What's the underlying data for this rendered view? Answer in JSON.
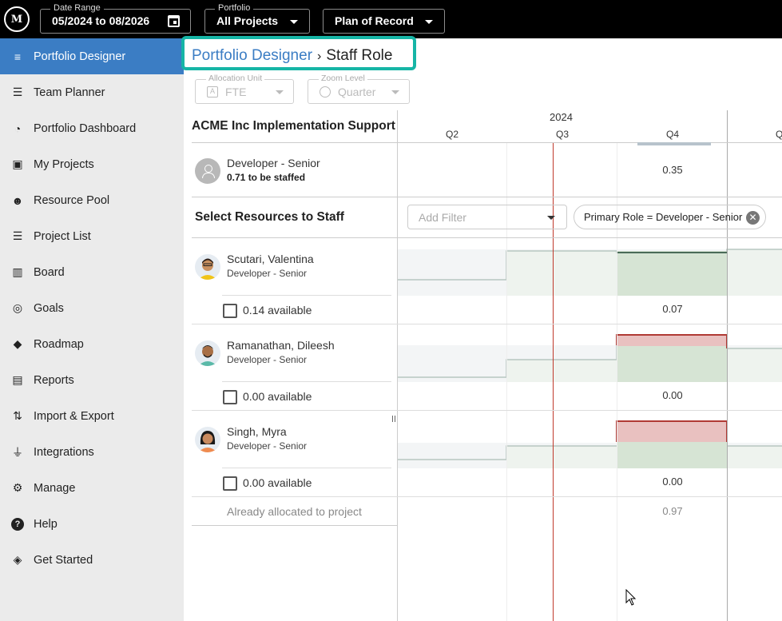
{
  "topbar": {
    "logo_text": "M",
    "date_range": {
      "label": "Date Range",
      "value": "05/2024 to 08/2026"
    },
    "portfolio": {
      "label": "Portfolio",
      "value": "All Projects"
    },
    "plan": {
      "value": "Plan of Record"
    }
  },
  "sidebar": {
    "items": [
      {
        "label": "Portfolio Designer",
        "icon": "designer-icon",
        "glyph": "≡",
        "active": true
      },
      {
        "label": "Team Planner",
        "icon": "team-planner-icon",
        "glyph": "☰"
      },
      {
        "label": "Portfolio Dashboard",
        "icon": "dashboard-icon",
        "glyph": "◔"
      },
      {
        "label": "My Projects",
        "icon": "my-projects-icon",
        "glyph": "▣"
      },
      {
        "label": "Resource Pool",
        "icon": "resource-pool-icon",
        "glyph": "☻"
      },
      {
        "label": "Project List",
        "icon": "list-icon",
        "glyph": "☰"
      },
      {
        "label": "Board",
        "icon": "board-icon",
        "glyph": "▥"
      },
      {
        "label": "Goals",
        "icon": "goals-icon",
        "glyph": "◎"
      },
      {
        "label": "Roadmap",
        "icon": "roadmap-icon",
        "glyph": "◆"
      },
      {
        "label": "Reports",
        "icon": "reports-icon",
        "glyph": "▤"
      },
      {
        "label": "Import & Export",
        "icon": "import-export-icon",
        "glyph": "⇅"
      },
      {
        "label": "Integrations",
        "icon": "plug-icon",
        "glyph": "⏚"
      },
      {
        "label": "Manage",
        "icon": "gear-icon",
        "glyph": "⚙"
      },
      {
        "label": "Help",
        "icon": "help-icon",
        "glyph": "?"
      },
      {
        "label": "Get Started",
        "icon": "compass-icon",
        "glyph": "◈"
      }
    ]
  },
  "breadcrumb": {
    "parent": "Portfolio Designer",
    "separator": "›",
    "current": "Staff Role"
  },
  "controls": {
    "allocation_unit": {
      "label": "Allocation Unit",
      "value": "FTE"
    },
    "zoom_level": {
      "label": "Zoom Level",
      "value": "Quarter"
    }
  },
  "grid": {
    "project_title": "ACME Inc Implementation Support",
    "year": "2024",
    "quarters": [
      "Q2",
      "Q3",
      "Q4",
      "Q"
    ]
  },
  "role": {
    "name": "Developer - Senior",
    "staffing": "0.71 to be staffed",
    "q4_value": "0.35"
  },
  "staffing": {
    "title": "Select Resources to Staff",
    "filter_placeholder": "Add Filter",
    "chip": "Primary Role = Developer - Senior"
  },
  "resources": [
    {
      "name": "Scutari, Valentina",
      "role": "Developer - Senior",
      "available": "0.14 available",
      "q4_value": "0.07",
      "over": false
    },
    {
      "name": "Ramanathan, Dileesh",
      "role": "Developer - Senior",
      "available": "0.00 available",
      "q4_value": "0.00",
      "over": true
    },
    {
      "name": "Singh, Myra",
      "role": "Developer - Senior",
      "available": "0.00 available",
      "q4_value": "0.00",
      "over": true
    }
  ],
  "already_allocated": {
    "label": "Already allocated to project",
    "value": "0.97"
  }
}
